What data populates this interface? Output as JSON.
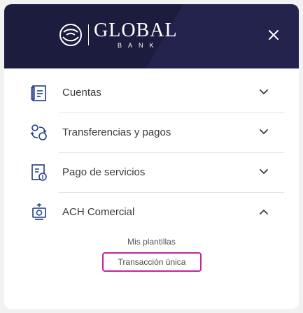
{
  "brand": {
    "name": "GLOBAL",
    "subtitle": "BANK",
    "header_color": "#1c1c3f",
    "accent_color": "#c6229b",
    "icon_color": "#1f3a8a"
  },
  "header": {
    "close_icon": "close-icon"
  },
  "menu": {
    "items": [
      {
        "label": "Cuentas",
        "icon": "accounts-icon",
        "expanded": false
      },
      {
        "label": "Transferencias y pagos",
        "icon": "transfers-icon",
        "expanded": false
      },
      {
        "label": "Pago de servicios",
        "icon": "services-payment-icon",
        "expanded": false
      },
      {
        "label": "ACH Comercial",
        "icon": "ach-commercial-icon",
        "expanded": true
      }
    ]
  },
  "submenu": {
    "items": [
      {
        "label": "Mis plantillas",
        "selected": false
      },
      {
        "label": "Transacción única",
        "selected": true
      }
    ]
  }
}
